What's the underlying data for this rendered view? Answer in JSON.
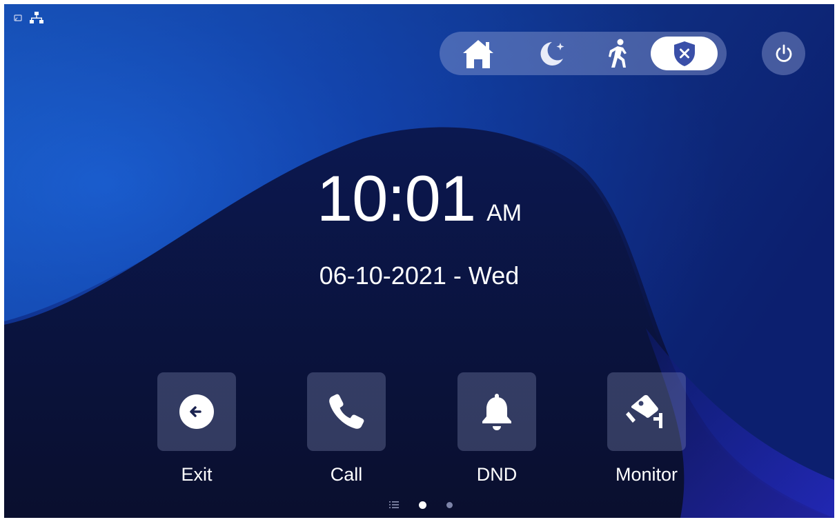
{
  "status_bar": {
    "icons": [
      "cast-icon",
      "network-icon"
    ]
  },
  "mode_switcher": {
    "modes": [
      {
        "name": "home",
        "icon": "home-icon",
        "active": false
      },
      {
        "name": "night",
        "icon": "moon-icon",
        "active": false
      },
      {
        "name": "away",
        "icon": "walking-person-icon",
        "active": false
      },
      {
        "name": "disarm",
        "icon": "shield-x-icon",
        "active": true
      }
    ],
    "power_icon": "power-icon"
  },
  "clock": {
    "time": "10:01",
    "ampm": "AM",
    "date": "06-10-2021 - Wed"
  },
  "actions": [
    {
      "label": "Exit",
      "icon": "exit-arrow-icon"
    },
    {
      "label": "Call",
      "icon": "phone-icon"
    },
    {
      "label": "DND",
      "icon": "bell-icon"
    },
    {
      "label": "Monitor",
      "icon": "camera-icon"
    }
  ],
  "pager": {
    "list_icon": "list-icon",
    "pages": 2,
    "current": 1
  },
  "colors": {
    "background": "#0b1238",
    "wave": "#1a5fd0",
    "accent_icon": "#3a4fa8"
  }
}
